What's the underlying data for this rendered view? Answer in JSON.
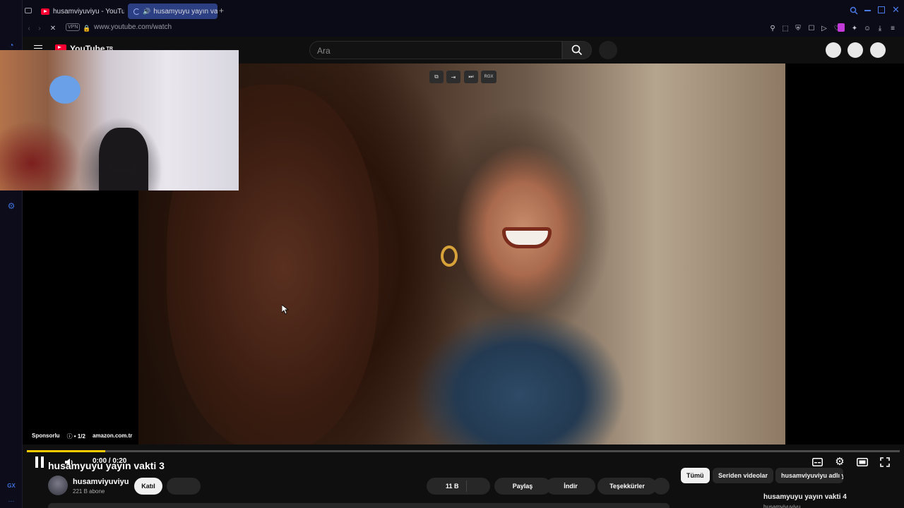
{
  "browser": {
    "tabs": [
      {
        "label": "husamviyuviyu - YouTube"
      },
      {
        "label": "husamyuyu yayın vakt"
      }
    ],
    "url": "www.youtube.com/watch",
    "vpn_label": "VPN",
    "sidebar_bottom_label": "GX",
    "sidebar_more": "···"
  },
  "youtube": {
    "logo_text": "YouTube",
    "region": "TR",
    "search_placeholder": "Ara",
    "video_overlay_buttons": [
      "⧉",
      "⇥",
      "⏭",
      "RGX"
    ],
    "ad": {
      "sponsored": "Sponsorlu",
      "counter": "• 1/2",
      "domain": "amazon.com.tr",
      "progress": 0.09
    },
    "player": {
      "time": "0:00 / 0:20",
      "state": "playing"
    },
    "video": {
      "title": "husamyuyu yayın vakti 3",
      "channel": "husamviyuviyu",
      "subscribers": "221 B abone",
      "join": "Katıl",
      "likes": "11 B",
      "share": "Paylaş",
      "download": "İndir",
      "thanks": "Teşekkürler"
    },
    "chips": [
      "Tümü",
      "Seriden videolar",
      "husamviyuviyu adlı yü"
    ],
    "next": {
      "title": "husamyuyu yayın vakti 4",
      "channel": "husamviyuviyu"
    }
  }
}
